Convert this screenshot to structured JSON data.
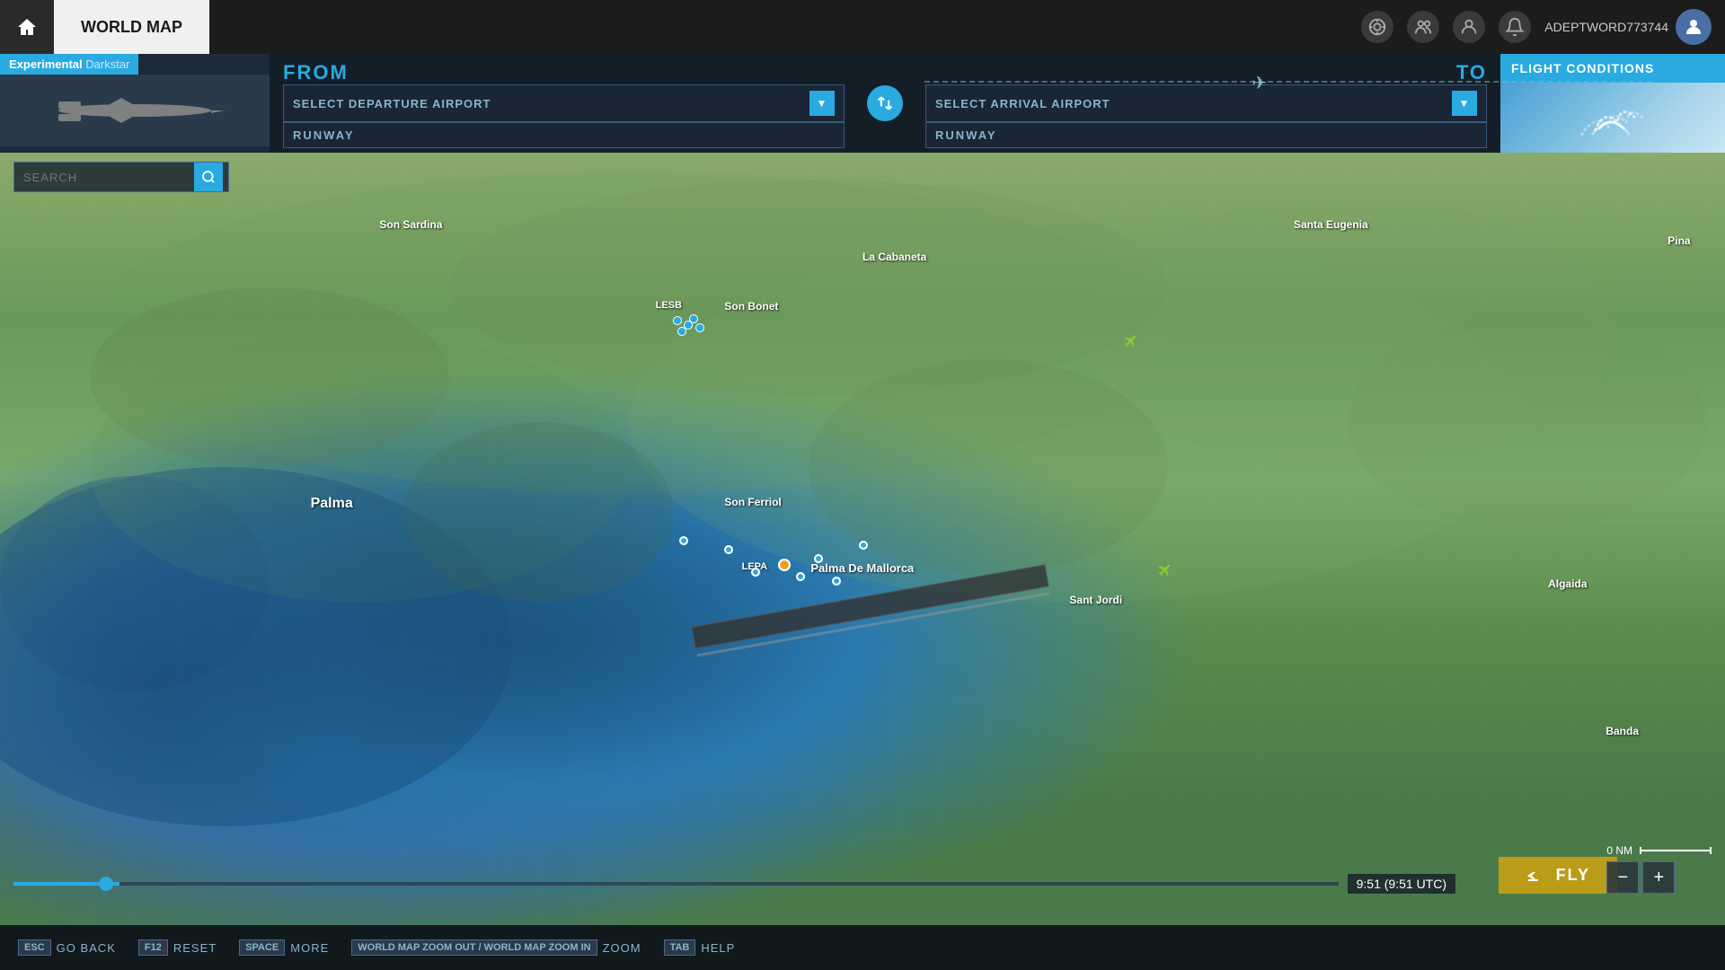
{
  "topbar": {
    "home_label": "⌂",
    "title": "WORLD MAP",
    "icons": {
      "target": "◎",
      "group": "👥",
      "user": "👤",
      "bell": "🔔"
    },
    "username": "ADEPTWORD773744"
  },
  "sidebar": {
    "tag_experimental": "Experimental",
    "tag_darkstar": " Darkstar"
  },
  "flight_planner": {
    "from_label": "FROM",
    "to_label": "TO",
    "departure_placeholder": "SELECT DEPARTURE AIRPORT",
    "departure_runway": "RUNWAY",
    "arrival_placeholder": "SELECT ARRIVAL AIRPORT",
    "arrival_runway": "RUNWAY",
    "swap_icon": "⇄"
  },
  "flight_conditions": {
    "title": "FLIGHT CONDITIONS"
  },
  "map": {
    "labels": {
      "son_sardina": "Son Sardina",
      "la_cabaneta": "La Cabaneta",
      "santa_eugenia": "Santa Eugenia",
      "pina": "Pina",
      "palma": "Palma",
      "son_ferriol": "Son Ferriol",
      "lesb": "LESB",
      "son_bonet": "Son Bonet",
      "lepa": "LEPA",
      "palma_mallorca": "Palma De Mallorca",
      "sant_jordi": "Sant Jordi",
      "algaida": "Algaida",
      "banda": "Banda"
    }
  },
  "search": {
    "placeholder": "SEARCH",
    "icon": "🔍"
  },
  "zoom": {
    "scale_label": "0 NM",
    "minus": "−",
    "plus": "+"
  },
  "fly_button": {
    "icon": "✈",
    "label": "FLY"
  },
  "time": {
    "display": "9:51 (9:51 UTC)"
  },
  "bottom_bar": {
    "shortcuts": [
      {
        "key": "ESC",
        "label": "GO BACK"
      },
      {
        "key": "F12",
        "label": "RESET"
      },
      {
        "key": "SPACE",
        "label": "MORE"
      },
      {
        "key": "WORLD MAP ZOOM OUT / WORLD MAP ZOOM IN",
        "label": "ZOOM"
      },
      {
        "key": "TAB",
        "label": "HELP"
      }
    ]
  }
}
